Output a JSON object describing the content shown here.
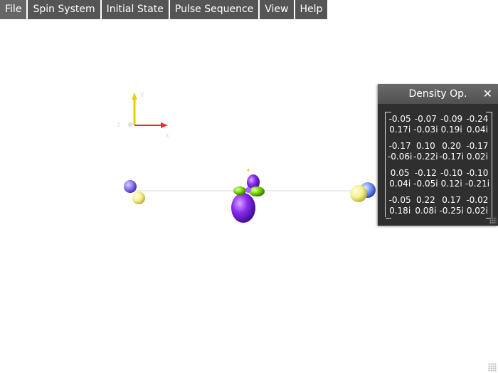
{
  "menu": [
    {
      "label": "File"
    },
    {
      "label": "Spin System"
    },
    {
      "label": "Initial State"
    },
    {
      "label": "Pulse Sequence"
    },
    {
      "label": "View"
    },
    {
      "label": "Help"
    }
  ],
  "axes": {
    "x_label": "x",
    "y_label": "y",
    "z_label": "z",
    "x_color": "#e03030",
    "y_color": "#e8d000"
  },
  "density_panel": {
    "title": "Density Op.",
    "close_icon": "close-icon",
    "rows": [
      [
        {
          "re": "-0.05",
          "im": "0.17i"
        },
        {
          "re": "-0.07",
          "im": "-0.03i"
        },
        {
          "re": "-0.09",
          "im": "0.19i"
        },
        {
          "re": "-0.24",
          "im": "0.04i"
        }
      ],
      [
        {
          "re": "-0.17",
          "im": "-0.06i"
        },
        {
          "re": "0.10",
          "im": "-0.22i"
        },
        {
          "re": "0.20",
          "im": "-0.17i"
        },
        {
          "re": "-0.17",
          "im": "0.02i"
        }
      ],
      [
        {
          "re": "0.05",
          "im": "0.04i"
        },
        {
          "re": "-0.12",
          "im": "-0.05i"
        },
        {
          "re": "-0.10",
          "im": "0.12i"
        },
        {
          "re": "-0.10",
          "im": "-0.21i"
        }
      ],
      [
        {
          "re": "-0.05",
          "im": "0.18i"
        },
        {
          "re": "0.22",
          "im": "0.08i"
        },
        {
          "re": "0.17",
          "im": "-0.25i"
        },
        {
          "re": "-0.02",
          "im": "0.02i"
        }
      ]
    ]
  },
  "colors": {
    "menu_bg": "#555555",
    "panel_bg": "#2f2f2f",
    "orbital_purple": "#7a1fe0",
    "orbital_green": "#6fd400",
    "sphere_yellow": "#f4f08a",
    "sphere_blue": "#6c8ff5"
  }
}
